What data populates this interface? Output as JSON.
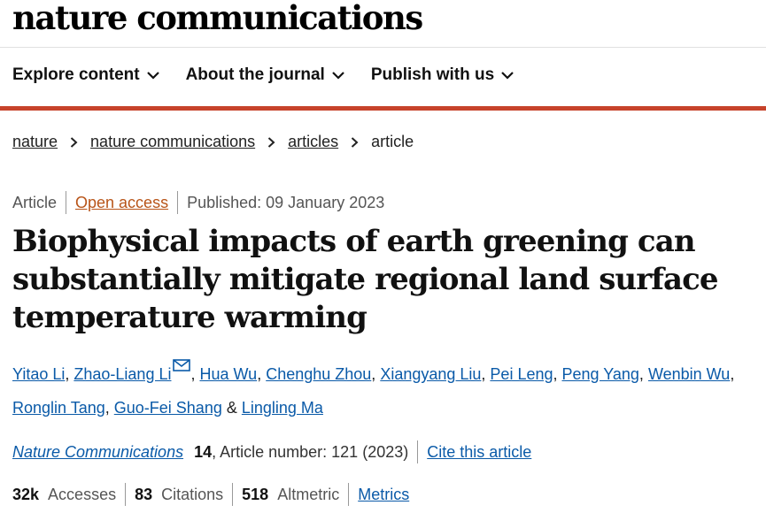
{
  "site": {
    "logo": "nature communications"
  },
  "nav": {
    "items": [
      {
        "label": "Explore content"
      },
      {
        "label": "About the journal"
      },
      {
        "label": "Publish with us"
      }
    ]
  },
  "breadcrumb": [
    "nature",
    "nature communications",
    "articles",
    "article"
  ],
  "article": {
    "type": "Article",
    "access": "Open access",
    "published": "Published: 09 January 2023",
    "title": "Biophysical impacts of earth greening can substantially mitigate regional land surface temperature warming",
    "authors": [
      "Yitao Li",
      "Zhao-Liang Li",
      "Hua Wu",
      "Chenghu Zhou",
      "Xiangyang Liu",
      "Pei Leng",
      "Peng Yang",
      "Wenbin Wu",
      "Ronglin Tang",
      "Guo-Fei Shang",
      "Lingling Ma"
    ],
    "journal": "Nature Communications",
    "volume": "14",
    "article_number": ", Article number: 121 (2023)",
    "cite_label": "Cite this article"
  },
  "metrics": {
    "accesses_value": "32k",
    "accesses_label": "Accesses",
    "citations_value": "83",
    "citations_label": "Citations",
    "altmetric_value": "518",
    "altmetric_label": "Altmetric",
    "metrics_link": "Metrics"
  },
  "colors": {
    "accent_red": "#c7432b",
    "link": "#0a5aa8",
    "open_access": "#b85418"
  }
}
